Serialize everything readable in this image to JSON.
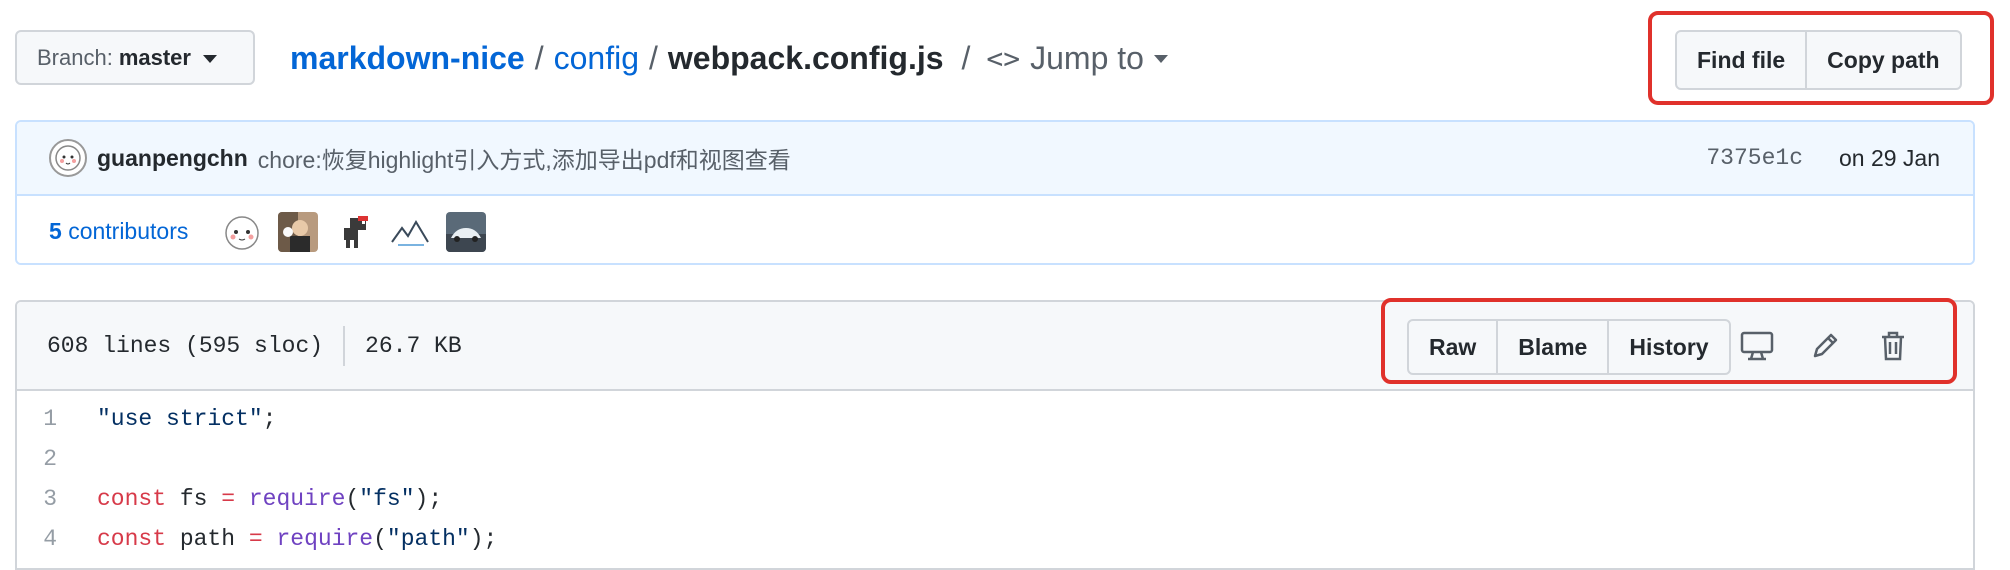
{
  "branch": {
    "label": "Branch:",
    "value": "master"
  },
  "breadcrumb": {
    "repo": "markdown-nice",
    "sep1": "/",
    "folder": "config",
    "sep2": "/",
    "file": "webpack.config.js",
    "sep3": "/",
    "jump_icon": "<>",
    "jump_label": "Jump to"
  },
  "file_actions": {
    "find_file": "Find file",
    "copy_path": "Copy path"
  },
  "commit": {
    "author": "guanpengchn",
    "message": "chore:恢复highlight引入方式,添加导出pdf和视图查看",
    "sha": "7375e1c",
    "date": "on 29 Jan"
  },
  "contributors": {
    "count": "5",
    "label": "contributors",
    "avatars": [
      "avatar-sketch-face",
      "avatar-photo-person",
      "avatar-dinosaur",
      "avatar-mountains",
      "avatar-car"
    ]
  },
  "file_info": {
    "lines": "608 lines (595 sloc)",
    "size": "26.7 KB"
  },
  "view_buttons": {
    "raw": "Raw",
    "blame": "Blame",
    "history": "History"
  },
  "tool_icons": [
    "desktop-icon",
    "pencil-icon",
    "trash-icon"
  ],
  "code_lines": [
    {
      "n": "1",
      "tokens": [
        {
          "t": "\"use strict\"",
          "c": "str"
        },
        {
          "t": ";",
          "c": "plain"
        }
      ]
    },
    {
      "n": "2",
      "tokens": []
    },
    {
      "n": "3",
      "tokens": [
        {
          "t": "const",
          "c": "kw"
        },
        {
          "t": " fs ",
          "c": "plain"
        },
        {
          "t": "=",
          "c": "kw"
        },
        {
          "t": " ",
          "c": "plain"
        },
        {
          "t": "require",
          "c": "fn"
        },
        {
          "t": "(",
          "c": "plain"
        },
        {
          "t": "\"fs\"",
          "c": "str"
        },
        {
          "t": ");",
          "c": "plain"
        }
      ]
    },
    {
      "n": "4",
      "tokens": [
        {
          "t": "const",
          "c": "kw"
        },
        {
          "t": " path ",
          "c": "plain"
        },
        {
          "t": "=",
          "c": "kw"
        },
        {
          "t": " ",
          "c": "plain"
        },
        {
          "t": "require",
          "c": "fn"
        },
        {
          "t": "(",
          "c": "plain"
        },
        {
          "t": "\"path\"",
          "c": "str"
        },
        {
          "t": ");",
          "c": "plain"
        }
      ]
    }
  ],
  "colors": {
    "highlight_box": "#e0312b",
    "link": "#0366d6",
    "commit_bg": "#f1f8ff"
  }
}
